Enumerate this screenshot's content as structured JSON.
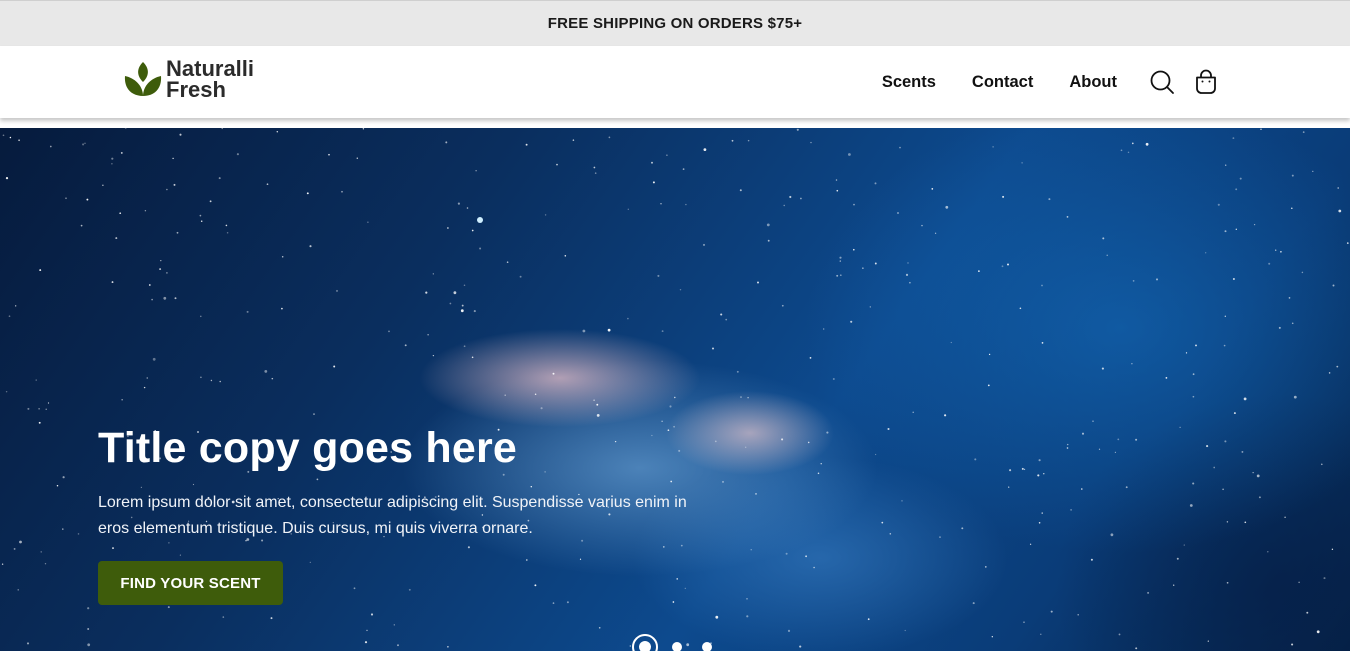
{
  "announcement": {
    "text": "FREE SHIPPING ON ORDERS $75+"
  },
  "brand": {
    "line1": "Naturalli",
    "line2": "Fresh",
    "color": "#3e5c0b"
  },
  "nav": {
    "links": [
      {
        "label": "Scents"
      },
      {
        "label": "Contact"
      },
      {
        "label": "About"
      }
    ],
    "icons": [
      "search-icon",
      "shopping-bag-icon"
    ]
  },
  "hero": {
    "title": "Title copy goes here",
    "body": "Lorem ipsum dolor sit amet, consectetur adipiscing elit. Suspendisse varius enim in eros elementum tristique. Duis cursus, mi quis viverra ornare.",
    "cta_label": "FIND YOUR SCENT",
    "cta_color": "#3e5c0b",
    "slides": {
      "count": 3,
      "active": 1
    }
  }
}
